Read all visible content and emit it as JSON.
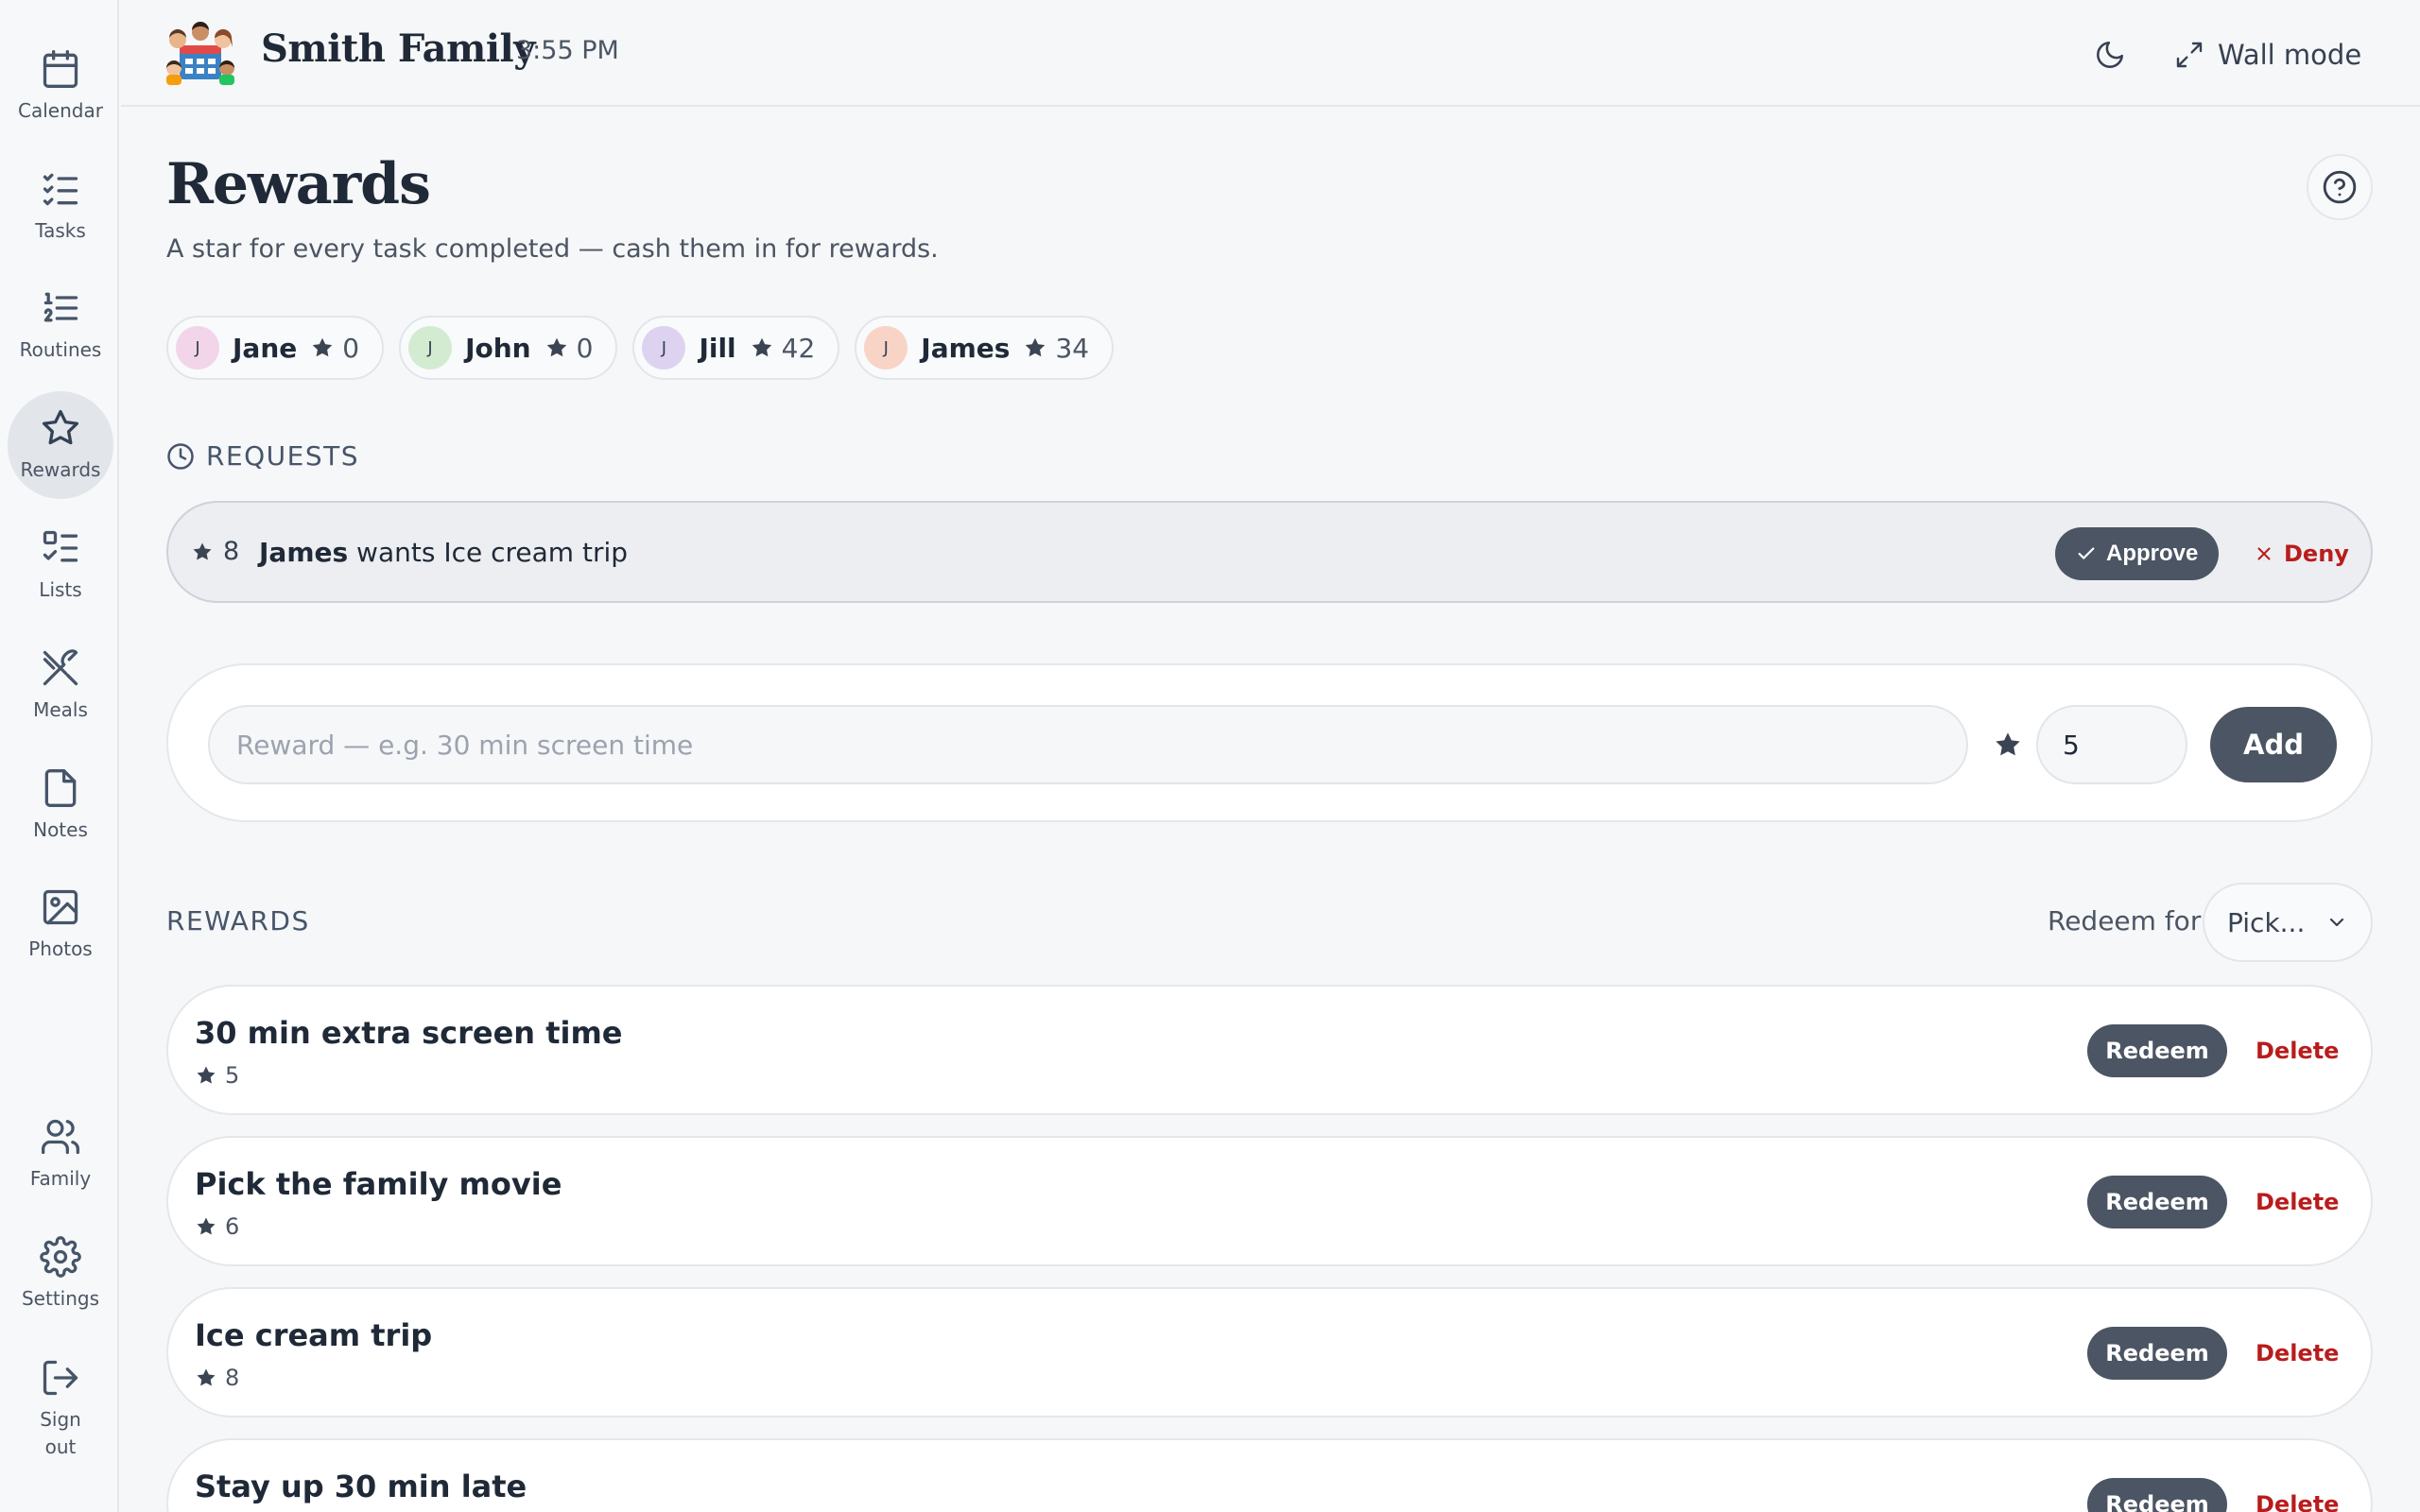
{
  "sidebar": {
    "items": [
      {
        "label": "Calendar",
        "icon": "calendar-icon"
      },
      {
        "label": "Tasks",
        "icon": "checklist-icon"
      },
      {
        "label": "Routines",
        "icon": "numbered-list-icon"
      },
      {
        "label": "Rewards",
        "icon": "star-icon",
        "active": true
      },
      {
        "label": "Lists",
        "icon": "list-checks-icon"
      },
      {
        "label": "Meals",
        "icon": "utensils-icon"
      },
      {
        "label": "Notes",
        "icon": "note-icon"
      },
      {
        "label": "Photos",
        "icon": "image-icon"
      }
    ],
    "bottom": [
      {
        "label": "Family",
        "icon": "users-icon"
      },
      {
        "label": "Settings",
        "icon": "gear-icon"
      },
      {
        "label": "Sign out",
        "icon": "sign-out-icon"
      }
    ]
  },
  "header": {
    "family_name": "Smith Family",
    "time": "3:55 PM",
    "wall_mode_label": "Wall mode"
  },
  "page": {
    "title": "Rewards",
    "subtitle": "A star for every task completed — cash them in for rewards."
  },
  "members": [
    {
      "initial": "J",
      "name": "Jane",
      "stars": "0",
      "color": "#f3d5ea"
    },
    {
      "initial": "J",
      "name": "John",
      "stars": "0",
      "color": "#d3ecd1"
    },
    {
      "initial": "J",
      "name": "Jill",
      "stars": "42",
      "color": "#ddd3f1"
    },
    {
      "initial": "J",
      "name": "James",
      "stars": "34",
      "color": "#f8d4c7"
    }
  ],
  "requests": {
    "heading": "REQUESTS",
    "items": [
      {
        "stars": "8",
        "who": "James",
        "text": " wants Ice cream trip",
        "approve_label": "Approve",
        "deny_label": "Deny"
      }
    ]
  },
  "add_form": {
    "reward_placeholder": "Reward — e.g. 30 min screen time",
    "stars_value": "5",
    "add_label": "Add"
  },
  "rewards": {
    "heading": "REWARDS",
    "redeem_for_label": "Redeem for",
    "redeem_for_value": "Pick...",
    "items": [
      {
        "title": "30 min extra screen time",
        "stars": "5",
        "redeem_label": "Redeem",
        "delete_label": "Delete"
      },
      {
        "title": "Pick the family movie",
        "stars": "6",
        "redeem_label": "Redeem",
        "delete_label": "Delete"
      },
      {
        "title": "Ice cream trip",
        "stars": "8",
        "redeem_label": "Redeem",
        "delete_label": "Delete"
      },
      {
        "title": "Stay up 30 min late",
        "stars": "",
        "redeem_label": "Redeem",
        "delete_label": "Delete"
      }
    ]
  },
  "colors": {
    "primary_button": "#4b5563",
    "danger_text": "#b91c1c",
    "background": "#f6f7f9"
  }
}
